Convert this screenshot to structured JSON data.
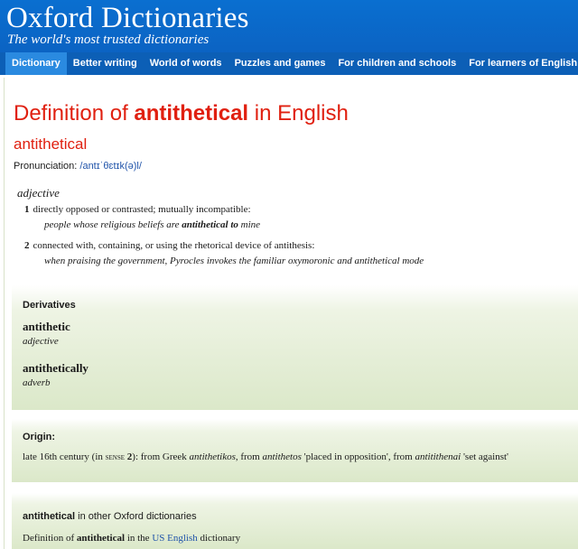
{
  "header": {
    "brand": "Oxford Dictionaries",
    "tagline": "The world's most trusted dictionaries"
  },
  "nav": {
    "items": [
      {
        "label": "Dictionary",
        "active": true
      },
      {
        "label": "Better writing",
        "active": false
      },
      {
        "label": "World of words",
        "active": false
      },
      {
        "label": "Puzzles and games",
        "active": false
      },
      {
        "label": "For children and schools",
        "active": false
      },
      {
        "label": "For learners of English",
        "active": false
      }
    ]
  },
  "entry": {
    "title_prefix": "Definition of ",
    "title_word": "antithetical",
    "title_suffix": " in English",
    "headword": "antithetical",
    "pronunciation_label": "Pronunciation: ",
    "pronunciation": "/antɪˈθɛtɪk(ə)l/",
    "pos": "adjective",
    "senses": [
      {
        "num": "1",
        "definition": "directly opposed or contrasted; mutually incompatible:",
        "example_pre": "people whose religious beliefs are ",
        "example_bold": "antithetical to",
        "example_post": " mine"
      },
      {
        "num": "2",
        "definition": "connected with, containing, or using the rhetorical device of antithesis:",
        "example_pre": "when praising the government, Pyrocles invokes the familiar oxymoronic and antithetical mode",
        "example_bold": "",
        "example_post": ""
      }
    ]
  },
  "derivatives": {
    "heading": "Derivatives",
    "items": [
      {
        "word": "antithetic",
        "pos": "adjective"
      },
      {
        "word": "antithetically",
        "pos": "adverb"
      }
    ]
  },
  "origin": {
    "heading": "Origin:",
    "t1": "late 16th century (in ",
    "t2": "sense",
    "t3": " ",
    "t4": "2",
    "t5": "): from Greek ",
    "t6": "antithetikos",
    "t7": ", from ",
    "t8": "antithetos",
    "t9": " 'placed in opposition', from ",
    "t10": "antitithenai",
    "t11": " 'set against'"
  },
  "other": {
    "heading_word": "antithetical",
    "heading_rest": " in other Oxford dictionaries",
    "line_pre": "Definition of ",
    "line_word": "antithetical",
    "line_mid": " in the ",
    "line_link": "US English",
    "line_post": " dictionary"
  }
}
